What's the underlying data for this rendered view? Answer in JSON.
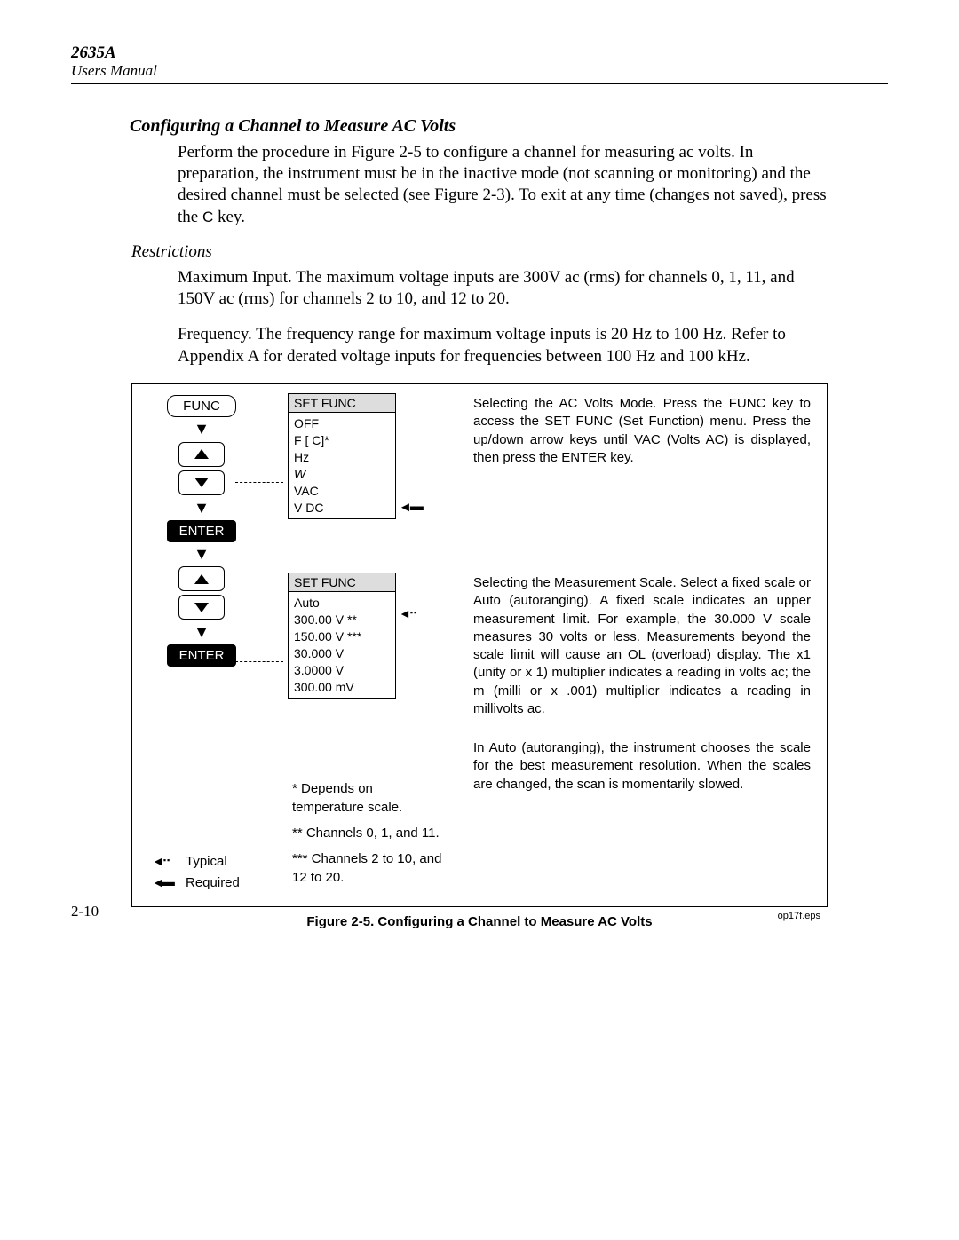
{
  "header": {
    "model": "2635A",
    "subtitle": "Users Manual"
  },
  "heading": "Configuring a Channel to Measure AC Volts",
  "para1_a": "Perform the procedure in Figure 2-5 to configure a channel for measuring ac volts. In preparation, the instrument must be in the inactive mode (not scanning or monitoring) and the desired channel must be selected (see Figure 2-3). To exit at any time (changes not saved), press the ",
  "para1_key": "C",
  "para1_b": " key.",
  "sub1": "Restrictions",
  "para2": "Maximum Input. The maximum voltage inputs are 300V ac (rms) for channels 0, 1, 11, and 150V ac (rms) for channels 2 to 10, and 12 to 20.",
  "para3": "Frequency. The frequency range for maximum voltage inputs is 20 Hz to 100 Hz. Refer to Appendix A for derated voltage inputs for frequencies between 100 Hz and 100 kHz.",
  "figure": {
    "flow": {
      "func": "FUNC",
      "enter": "ENTER"
    },
    "menu1": {
      "title": "SET FUNC",
      "items": [
        "OFF",
        " F [  C]*",
        "Hz",
        "W",
        "VAC",
        "V DC"
      ]
    },
    "menu2": {
      "title": "SET FUNC",
      "items": [
        "Auto",
        "300.00 V **",
        "150.00 V ***",
        "30.000 V",
        "3.0000 V",
        "300.00 mV"
      ]
    },
    "desc1_a": "Selecting the AC Volts Mode",
    "desc1_b": ".  Press the FUNC key to access the SET FUNC (Set Function) menu.  Press the up/down arrow keys until VAC (Volts AC) is displayed, then press the ENTER key.",
    "desc2_a": "Selecting the Measurement Scale",
    "desc2_b": ".  Select a fixed scale or Auto (autoranging).  A fixed scale indicates an upper measurement limit.  For example, the 30.000 V scale measures 30 volts or less.  Measurements beyond the scale limit will cause an OL (overload) display.  The x1 (unity or x 1) multiplier indicates a reading in volts ac; the m (milli or x .001) multiplier indicates a reading in millivolts ac.",
    "desc3": "In Auto (autoranging), the instrument chooses the scale for the best measurement resolution.  When the scales are changed, the scan is momentarily slowed.",
    "legend": {
      "typical": "Typical",
      "required": "Required"
    },
    "footnotes": {
      "f1": "*  Depends on temperature scale.",
      "f2": "**  Channels 0, 1, and 11.",
      "f3": "*** Channels 2 to 10, and 12 to 20."
    },
    "caption": "Figure 2-5. Configuring a Channel to Measure AC Volts",
    "filename": "op17f.eps"
  },
  "pagenum": "2-10"
}
